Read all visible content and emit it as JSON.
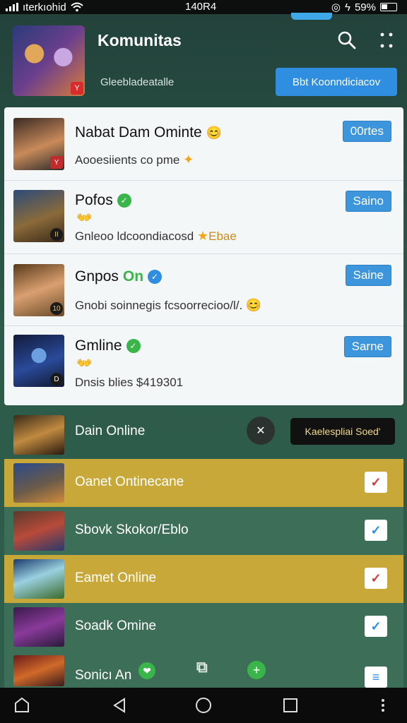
{
  "status_bar": {
    "carrier": "ıtеrkıohid",
    "time": "140R4",
    "battery": "59%"
  },
  "header": {
    "title": "Komunitas",
    "subtitle": "Gleebladeatalle",
    "join_button": "Bbt Koonndiciacov",
    "cover_badge": "Y"
  },
  "cards": [
    {
      "title": "Nabat Dam Ominte",
      "subtitle": "Aooesiients co pme",
      "button": "00rtes",
      "badge": "Y"
    },
    {
      "title": "Pofos",
      "subtitle": "Gnleoo ldcoondiacosd",
      "subtitle_accent": "Ebae",
      "button": "Saino",
      "badge": "II"
    },
    {
      "title": "Gnpos",
      "title_accent": "On",
      "subtitle": "Gnobi soinnegis fcsoorrecioo/l/.",
      "button": "Saine",
      "badge": "10"
    },
    {
      "title": "Gmline",
      "subtitle": "Dnsis blies $419301",
      "button": "Sarne",
      "badge": "D"
    }
  ],
  "list": [
    {
      "title": "Dain Online",
      "style": "dark",
      "tooltip": "Kaelespliai Soed'"
    },
    {
      "title": "Oanet Ontinecane",
      "style": "yellow",
      "check": "✓"
    },
    {
      "title": "Sbovk Skokor/Eblo",
      "style": "green",
      "check": "✓"
    },
    {
      "title": "Eamet Online",
      "style": "yellow",
      "check": "✓"
    },
    {
      "title": "Soadk Omine",
      "style": "green",
      "check": "✓"
    },
    {
      "title": "Sonicı An",
      "style": "green",
      "check": "≡"
    }
  ],
  "colors": {
    "accent_blue": "#2f8ee0",
    "verified_green": "#39b54a",
    "row_yellow": "#c9a83a",
    "row_green": "#3d6e57"
  }
}
